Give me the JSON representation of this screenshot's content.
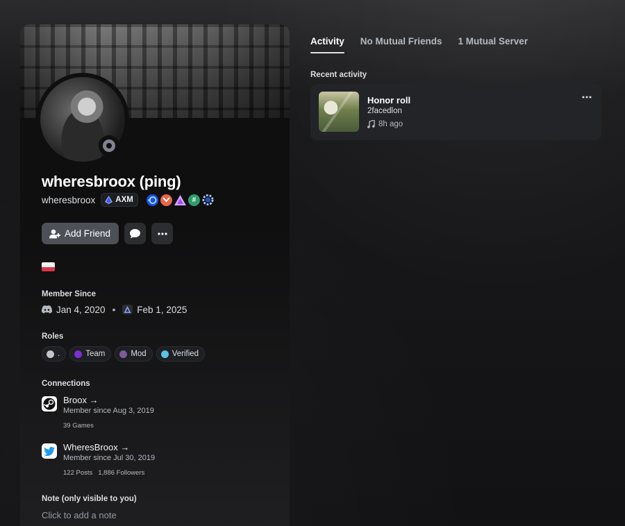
{
  "profile": {
    "display_name": "wheresbroox (ping)",
    "username": "wheresbroox",
    "guild_tag": "AXM",
    "badges": [
      {
        "icon": "nitro-badge",
        "color": "#3b7bff"
      },
      {
        "icon": "boost-heart-badge",
        "color": "#e8664a"
      },
      {
        "icon": "triangle-badge",
        "color": "#c77dff"
      },
      {
        "icon": "hashtag-badge",
        "color": "#43b581"
      },
      {
        "icon": "gear-badge",
        "color": "#5865f2"
      }
    ],
    "status": "offline"
  },
  "actions": {
    "add_friend_label": "Add Friend",
    "message_icon": "chat-bubble-icon",
    "more_icon": "ellipsis-icon"
  },
  "member_since": {
    "title": "Member Since",
    "discord_date": "Jan 4, 2020",
    "separator": "•",
    "server_date": "Feb 1, 2025"
  },
  "roles": {
    "title": "Roles",
    "items": [
      {
        "name": ".",
        "color": "#c4c5c9"
      },
      {
        "name": "Team",
        "color": "#7b2fd1"
      },
      {
        "name": "Mod",
        "color": "#7d5a9a"
      },
      {
        "name": "Verified",
        "color": "#5bc0eb"
      }
    ]
  },
  "connections": {
    "title": "Connections",
    "items": [
      {
        "name": "Broox →",
        "since": "Member since Aug 3, 2019",
        "meta": [
          "39 Games"
        ],
        "icon": "steam-icon"
      },
      {
        "name": "WheresBroox →",
        "since": "Member since Jul 30, 2019",
        "meta": [
          "122 Posts",
          "1,886 Followers"
        ],
        "icon": "twitter-icon"
      }
    ]
  },
  "note": {
    "title": "Note (only visible to you)",
    "placeholder": "Click to add a note"
  },
  "tabs": [
    "Activity",
    "No Mutual Friends",
    "1 Mutual Server"
  ],
  "activity": {
    "section_title": "Recent activity",
    "card": {
      "title": "Honor roll",
      "artist": "2facedlon",
      "time": "8h ago"
    }
  }
}
